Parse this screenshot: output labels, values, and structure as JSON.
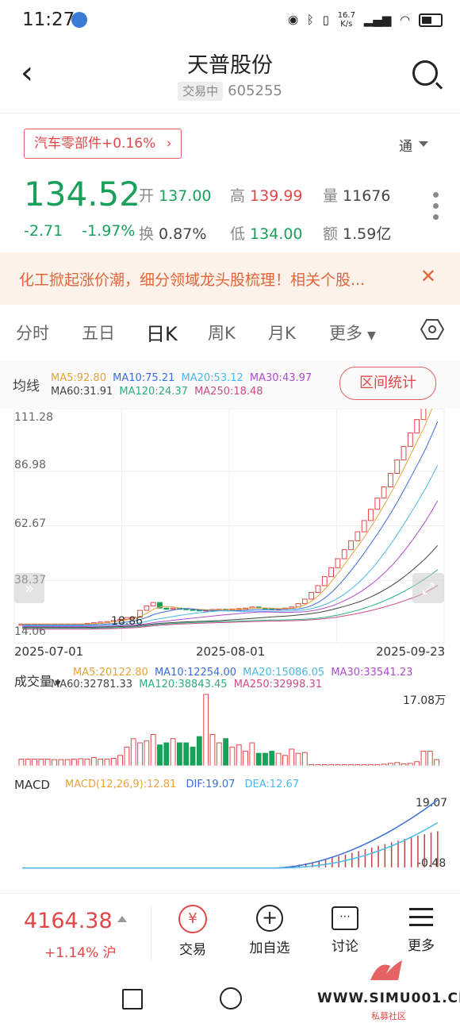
{
  "status": {
    "time": "11:27",
    "net_speed": "16.7\nK/s",
    "icons": [
      "eye-icon",
      "bluetooth-icon",
      "vibrate-icon",
      "5g-signal-icon",
      "wifi-icon",
      "battery-icon"
    ]
  },
  "header": {
    "title": "天普股份",
    "badge": "交易中",
    "code": "605255"
  },
  "sector": {
    "label": "汽车零部件",
    "change": "+0.16%"
  },
  "tong": "通",
  "quote": {
    "price": "134.52",
    "change": "-2.71",
    "change_pct": "-1.97%",
    "open_label": "开",
    "open": "137.00",
    "high_label": "高",
    "high": "139.99",
    "volume_label": "量",
    "volume": "11676",
    "turnover_label": "换",
    "turnover": "0.87%",
    "low_label": "低",
    "low": "134.00",
    "amount_label": "额",
    "amount": "1.59亿"
  },
  "news": {
    "text": "化工掀起涨价潮，细分领域龙头股梳理！相关个股..."
  },
  "tabs": [
    "分时",
    "五日",
    "日K",
    "周K",
    "月K",
    "更多"
  ],
  "active_tab": "日K",
  "ma": {
    "label": "均线",
    "ma5": "MA5:92.80",
    "ma10": "MA10:75.21",
    "ma20": "MA20:53.12",
    "ma30": "MA30:43.97",
    "ma60": "MA60:31.91",
    "ma120": "MA120:24.37",
    "ma250": "MA250:18.48",
    "stat_button": "区间统计"
  },
  "kline": {
    "y_ticks": [
      "111.28",
      "86.98",
      "62.67",
      "38.37",
      "14.06"
    ],
    "low_marker": "18.86",
    "dates": [
      "2025-07-01",
      "2025-08-01",
      "2025-09-23"
    ]
  },
  "volume": {
    "label": "成交量",
    "ma5": "MA5:20122.80",
    "ma10": "MA10:12254.00",
    "ma20": "MA20:15086.05",
    "ma30": "MA30:33541.23",
    "ma60": "MA60:32781.33",
    "ma120": "MA120:38843.45",
    "ma250": "MA250:32998.31",
    "max": "17.08万"
  },
  "macd": {
    "label": "MACD",
    "params": "MACD(12,26,9):12.81",
    "dif": "DIF:19.07",
    "dea": "DEA:12.67",
    "max": "19.07",
    "min": "-0.48"
  },
  "bottom": {
    "index_price": "4164.38",
    "index_change": "+1.14%",
    "index_market": "沪",
    "actions": [
      "交易",
      "加自选",
      "讨论",
      "更多"
    ]
  },
  "watermark": {
    "text": "WWW.SIMU001.CN",
    "sub": "私募社区"
  },
  "colors": {
    "up": "#e04848",
    "down": "#19a05a",
    "accent": "#e0663a"
  },
  "chart_data": [
    {
      "type": "candlestick",
      "title": "",
      "x": [
        "2025-07-01",
        "2025-08-01",
        "2025-09-23"
      ],
      "ylim": [
        14.06,
        111.28
      ],
      "series": [
        {
          "name": "MA5",
          "values": [
            92.8
          ]
        },
        {
          "name": "MA10",
          "values": [
            75.21
          ]
        },
        {
          "name": "MA20",
          "values": [
            53.12
          ]
        },
        {
          "name": "MA30",
          "values": [
            43.97
          ]
        },
        {
          "name": "MA60",
          "values": [
            31.91
          ]
        },
        {
          "name": "MA120",
          "values": [
            24.37
          ]
        },
        {
          "name": "MA250",
          "values": [
            18.48
          ]
        }
      ],
      "closes": [
        18.9,
        18.9,
        18.9,
        18.9,
        18.9,
        18.9,
        18.9,
        18.9,
        18.9,
        18.9,
        19.2,
        19.5,
        19.8,
        20.0,
        20.5,
        21.0,
        21.8,
        22.0,
        25.0,
        27.0,
        28.5,
        26.0,
        25.5,
        26.0,
        25.8,
        25.5,
        25.3,
        25.0,
        25.2,
        25.4,
        25.5,
        25.3,
        25.6,
        25.8,
        26.0,
        26.5,
        26.0,
        25.8,
        25.5,
        25.7,
        26.0,
        26.5,
        28.0,
        30.0,
        33.0,
        36.0,
        40.0,
        44.0,
        48.0,
        52.0,
        56.0,
        60.0,
        65.0,
        70.0,
        75.0,
        80.0,
        86.0,
        92.0,
        98.0,
        104.0,
        110.0,
        115.0,
        126.0,
        134.52
      ]
    },
    {
      "type": "bar",
      "title": "成交量",
      "max_label": "17.08万",
      "values": [
        1.6,
        1.6,
        1.6,
        1.6,
        1.6,
        1.5,
        1.5,
        1.5,
        1.6,
        1.7,
        1.6,
        2.0,
        1.6,
        1.6,
        1.8,
        2.5,
        4.5,
        6.5,
        5.5,
        6.0,
        7.5,
        5.0,
        5.5,
        6.5,
        5.5,
        5.5,
        4.5,
        7.0,
        17.08,
        7.5,
        5.5,
        6.5,
        4.5,
        5.0,
        3.5,
        5.5,
        3.0,
        3.0,
        3.5,
        3.0,
        2.5,
        4.0,
        3.0,
        3.2,
        0.3,
        0.3,
        0.3,
        0.3,
        0.3,
        0.3,
        0.3,
        0.3,
        0.3,
        0.3,
        0.3,
        0.4,
        0.6,
        0.8,
        0.5,
        0.6,
        1.0,
        3.5,
        3.5,
        1.5
      ]
    },
    {
      "type": "bar",
      "title": "MACD",
      "ylim": [
        -0.48,
        19.07
      ],
      "dif": 19.07,
      "dea": 12.67,
      "macd": 12.81
    }
  ]
}
